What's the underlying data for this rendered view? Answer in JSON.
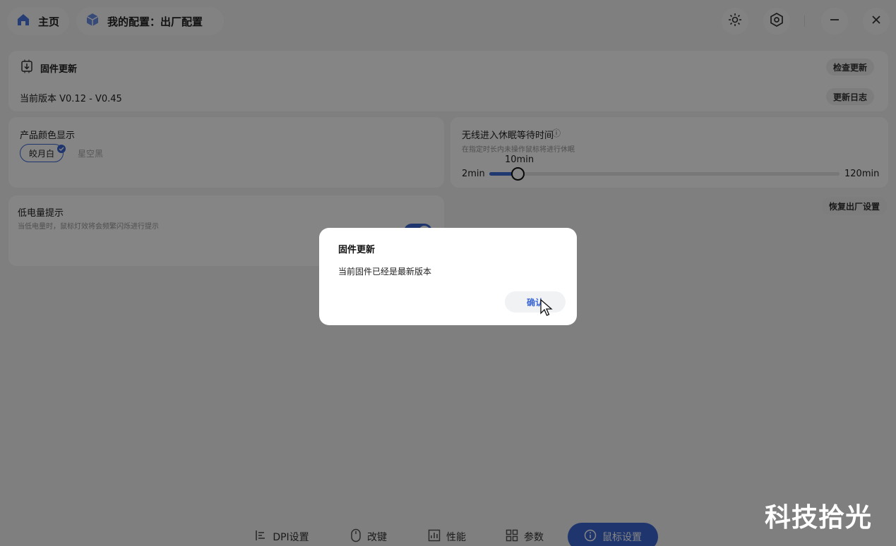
{
  "header": {
    "home_label": "主页",
    "config_label": "我的配置：出厂配置"
  },
  "firmware": {
    "title": "固件更新",
    "check_label": "检查更新",
    "version_text": "当前版本 V0.12 - V0.45",
    "changelog_label": "更新日志"
  },
  "color_display": {
    "title": "产品颜色显示",
    "options": [
      "皎月白",
      "星空黑"
    ],
    "selected": "皎月白"
  },
  "sleep": {
    "title": "无线进入休眠等待时间",
    "info_icon": "ⓘ",
    "subtitle": "在指定时长内未操作鼠标将进行休眠",
    "current_value": "10min",
    "min_label": "2min",
    "max_label": "120min",
    "fraction": 0.07
  },
  "low_battery": {
    "title": "低电量提示",
    "subtitle": "当低电量时，鼠标灯效将会频繁闪烁进行提示"
  },
  "restore_label": "恢复出厂设置",
  "nav": {
    "items": [
      "DPI设置",
      "改键",
      "性能",
      "参数",
      "鼠标设置"
    ],
    "active": "鼠标设置"
  },
  "dialog": {
    "title": "固件更新",
    "message": "当前固件已经是最新版本",
    "confirm_label": "确认"
  },
  "watermark": "科技拾光",
  "colors": {
    "accent": "#3b67d4",
    "overlay": "rgba(0,0,0,0.48)"
  }
}
